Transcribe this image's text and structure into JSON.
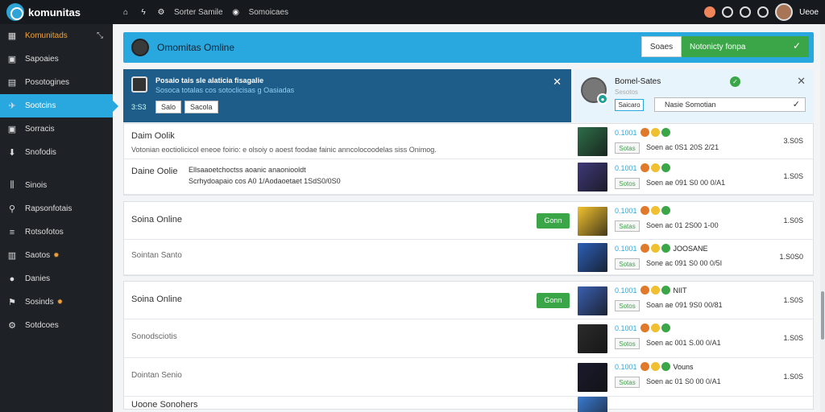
{
  "app": {
    "logo_text": "komunitas"
  },
  "topbar": {
    "link1": "Sorter Samile",
    "link2": "Somoicaes",
    "user_name": "Ueoe"
  },
  "sidebar": {
    "items": [
      {
        "label": "Komunitads",
        "icon": "grid-icon",
        "group": 1,
        "state": "first"
      },
      {
        "label": "Sapoaies",
        "icon": "square-icon",
        "group": 1
      },
      {
        "label": "Posotogines",
        "icon": "card-icon",
        "group": 1
      },
      {
        "label": "Sootcins",
        "icon": "bird-icon",
        "group": 1,
        "state": "active"
      },
      {
        "label": "Sorracis",
        "icon": "square-icon",
        "group": 1
      },
      {
        "label": "Snofodis",
        "icon": "download-icon",
        "group": 1
      },
      {
        "label": "Sinois",
        "icon": "stats-icon",
        "group": 2
      },
      {
        "label": "Rapsonfotais",
        "icon": "search-icon",
        "group": 2
      },
      {
        "label": "Rotsofotos",
        "icon": "list-icon",
        "group": 2
      },
      {
        "label": "Saotos",
        "icon": "chart-icon",
        "group": 2,
        "badge": "✹"
      },
      {
        "label": "Danies",
        "icon": "message-icon",
        "group": 2
      },
      {
        "label": "Sosinds",
        "icon": "flag-icon",
        "group": 2,
        "badge": "✹"
      },
      {
        "label": "Sotdcoes",
        "icon": "settings-icon",
        "group": 2
      }
    ]
  },
  "header": {
    "title": "Omomitas Omline",
    "search_label": "Soaes",
    "select_label": "Notonicty fonpa"
  },
  "notification": {
    "line1": "Posaio tais sle alaticia fisagalie",
    "line2": "Sosoca totalas cos sotoclicisas  g  Oasiadas",
    "number": "3:S3",
    "btn1": "Salo",
    "btn2": "Sacola"
  },
  "profile_card": {
    "name": "Bomel-Sates",
    "sub": "Sesotos",
    "button": "Saicaro",
    "select_value": "Nasie Somotian"
  },
  "sections": [
    {
      "rows": [
        {
          "title": "Daim Oolik",
          "desc": "Votonian eoctiolicicol eneoe foirio: e olsoiy o aoest foodae fainic anncolocoodelas siss Onimog.",
          "meta_id": "0.1001",
          "pill": "Sotas",
          "time": "Soen ac 0S1 20S 2/21",
          "amount": "3.S0S",
          "thumb": "#2f6e4a"
        },
        {
          "title": "Daine Oolie",
          "extra1": "Ellsaaoetchoctss aoanic anaoniooldt",
          "extra2": "Scrhydoapaio cos  A0  1/Aodaoetaet 1SdS0/0S0",
          "meta_id": "0.1001",
          "pill": "Sotos",
          "time": "Soen ae 091 S0 00 0/A1",
          "amount": "1.S0S",
          "thumb": "#3f3a7a"
        }
      ]
    },
    {
      "rows": [
        {
          "title": "Soina Online",
          "join": "Gonn",
          "meta_id": "0.1001",
          "pill": "Satas",
          "time": "Soen ac 01 2S00 1-00",
          "amount": "1.S0S",
          "thumb": "#f2c230"
        },
        {
          "title": "Sointan Santo",
          "muted": true,
          "meta_id": "0.1001",
          "tag": "JOOSANE",
          "pill": "Sotas",
          "time": "Sone ac 091 S0 00 0/5I",
          "amount": "1.S0S0",
          "thumb": "#2d5fb8"
        }
      ]
    },
    {
      "rows": [
        {
          "title": "Soina Online",
          "join": "Gonn",
          "meta_id": "0.1001",
          "tag": "NIIT",
          "pill": "Sotos",
          "time": "Soan ae 091 9S0 00/81",
          "amount": "1.S0S",
          "thumb": "#3b5fb0"
        },
        {
          "title": "Sonodsciotis",
          "muted": true,
          "meta_id": "0.1001",
          "pill": "Sotos",
          "time": "Soen ac 001 S.00 0/A1",
          "amount": "1.S0S",
          "thumb": "#2b2b2b"
        },
        {
          "title": "Dointan Senio",
          "muted": true,
          "meta_id": "0.1001",
          "tag": "Vouns",
          "pill": "Sotas",
          "time": "Soen ac 01 S0 00 0/A1",
          "amount": "1.S0S",
          "thumb": "#1a1a2e"
        },
        {
          "title": "Uoone Sonohers",
          "meta_id": "",
          "pill": "",
          "time": "",
          "amount": "",
          "thumb": "#3a7ad0"
        }
      ]
    }
  ]
}
